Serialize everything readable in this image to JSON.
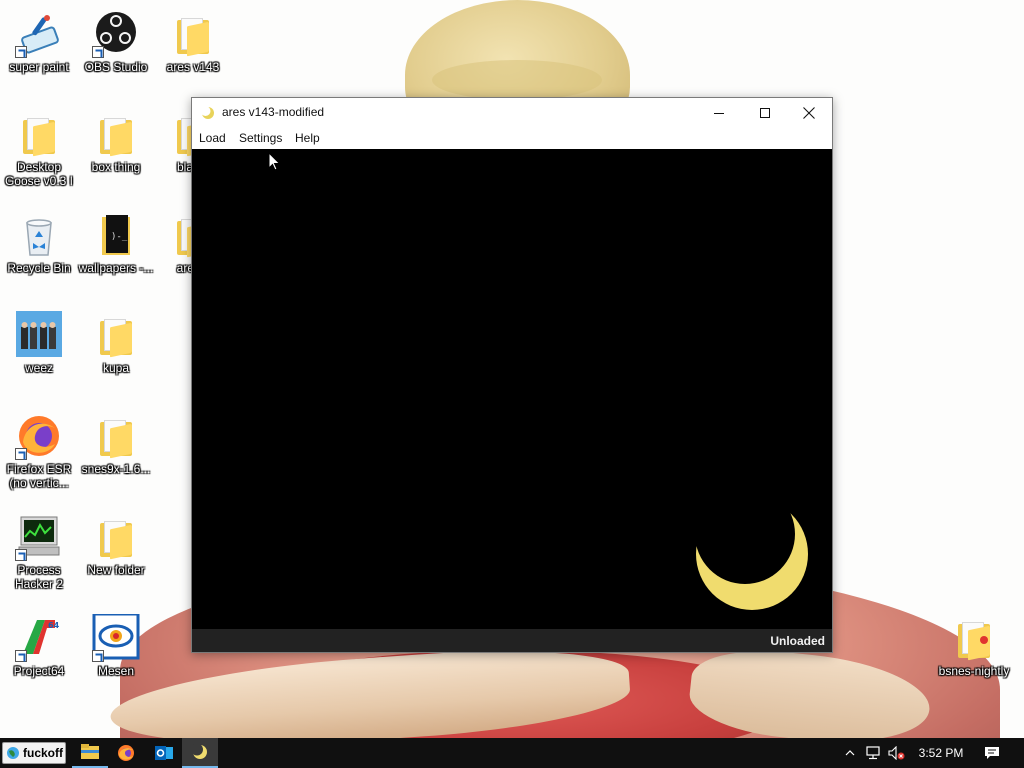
{
  "desktop": {
    "icons": [
      {
        "label": "super paint",
        "icon": "paint-app-icon"
      },
      {
        "label": "OBS Studio",
        "icon": "obs-icon"
      },
      {
        "label": "ares v143",
        "icon": "folder-icon"
      },
      {
        "label": "Desktop Goose v0.3 I",
        "icon": "folder-icon"
      },
      {
        "label": "box thing",
        "icon": "folder-icon"
      },
      {
        "label": "blaste",
        "icon": "folder-icon"
      },
      {
        "label": "Recycle Bin",
        "icon": "recycle-bin-icon"
      },
      {
        "label": "wallpapers -...",
        "icon": "dark-folder-icon"
      },
      {
        "label": "ares v",
        "icon": "folder-icon"
      },
      {
        "label": "weez",
        "icon": "image-icon"
      },
      {
        "label": "kupa",
        "icon": "folder-icon"
      },
      {
        "label": "Firefox ESR (no vertic...",
        "icon": "firefox-icon"
      },
      {
        "label": "snes9x-1.6...",
        "icon": "folder-icon"
      },
      {
        "label": "Process Hacker 2",
        "icon": "process-hacker-icon"
      },
      {
        "label": "New folder",
        "icon": "folder-icon"
      },
      {
        "label": "Project64",
        "icon": "project64-icon"
      },
      {
        "label": "Mesen",
        "icon": "mesen-icon"
      },
      {
        "label": "bsnes-nightly",
        "icon": "folder-icon"
      }
    ]
  },
  "window": {
    "title": "ares v143-modified",
    "menu": [
      "Load",
      "Settings",
      "Help"
    ],
    "status": "Unloaded",
    "moon_color": "#f0dc6e"
  },
  "taskbar": {
    "start_label": "fuckoff",
    "apps": [
      "file-explorer-icon",
      "firefox-icon",
      "outlook-icon",
      "ares-icon"
    ],
    "clock": "3:52 PM",
    "accent": "#76b9ed"
  }
}
